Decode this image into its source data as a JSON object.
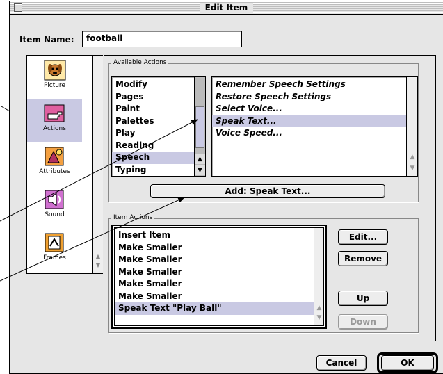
{
  "window": {
    "title": "Edit Item"
  },
  "item_name": {
    "label": "Item Name:",
    "value": "football"
  },
  "sidebar": {
    "items": [
      {
        "label": "Picture",
        "icon": "dog-picture-icon",
        "selected": false
      },
      {
        "label": "Actions",
        "icon": "pointing-hand-icon",
        "selected": true
      },
      {
        "label": "Attributes",
        "icon": "attributes-icon",
        "selected": false
      },
      {
        "label": "Sound",
        "icon": "speaker-icon",
        "selected": false
      },
      {
        "label": "Frames",
        "icon": "filmstrip-icon",
        "selected": false
      }
    ]
  },
  "available_actions": {
    "group_label": "Available Actions",
    "categories": [
      "Modify",
      "Pages",
      "Paint",
      "Palettes",
      "Play",
      "Reading",
      "Speech",
      "Typing"
    ],
    "selected_category": "Speech",
    "actions": [
      "Remember Speech Settings",
      "Restore Speech Settings",
      "Select Voice...",
      "Speak Text...",
      "Voice Speed..."
    ],
    "selected_action": "Speak Text...",
    "add_button": "Add:  Speak Text..."
  },
  "item_actions": {
    "group_label": "Item Actions",
    "rows": [
      "Insert Item",
      "Make Smaller",
      "Make Smaller",
      "Make Smaller",
      "Make Smaller",
      "Make Smaller",
      "Speak Text \"Play Ball\""
    ],
    "selected_row": "Speak Text \"Play Ball\"",
    "buttons": {
      "edit": "Edit...",
      "remove": "Remove",
      "up": "Up",
      "down": "Down"
    }
  },
  "footer": {
    "cancel": "Cancel",
    "ok": "OK"
  },
  "colors": {
    "selection": "#c9c9e3",
    "window_bg": "#e6e6e6"
  }
}
